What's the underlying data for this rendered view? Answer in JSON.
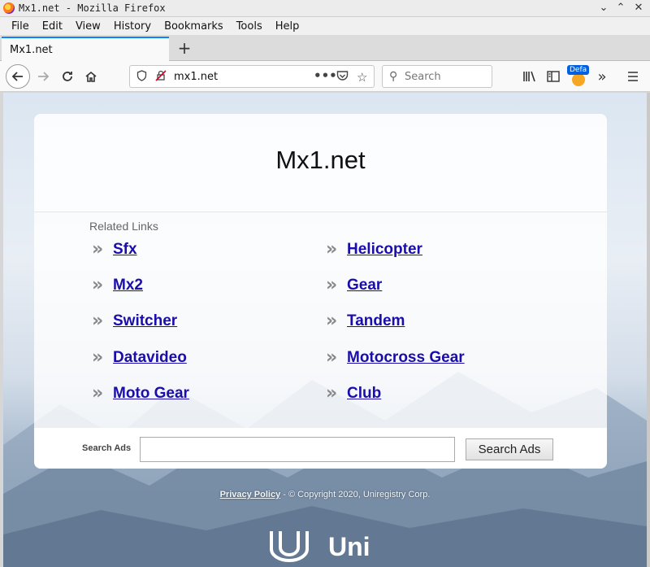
{
  "window": {
    "title": "Mx1.net - Mozilla Firefox",
    "minimize": "⌄",
    "maximize": "⌃",
    "close": "✕"
  },
  "menu": [
    "File",
    "Edit",
    "View",
    "History",
    "Bookmarks",
    "Tools",
    "Help"
  ],
  "tab": {
    "title": "Mx1.net",
    "new_tab": "+"
  },
  "nav": {
    "url": "mx1.net",
    "search_placeholder": "Search",
    "extension_badge": "Defa"
  },
  "page": {
    "title": "Mx1.net",
    "related_label": "Related Links",
    "links_left": [
      "Sfx",
      "Mx2",
      "Switcher",
      "Datavideo",
      "Moto Gear"
    ],
    "links_right": [
      "Helicopter",
      "Gear",
      "Tandem",
      "Motocross Gear",
      "Club"
    ],
    "search_label": "Search Ads",
    "search_button": "Search Ads",
    "footer_privacy": "Privacy Policy",
    "footer_copyright": " - © Copyright 2020, Uniregistry Corp.",
    "logo_text": "Uni"
  }
}
